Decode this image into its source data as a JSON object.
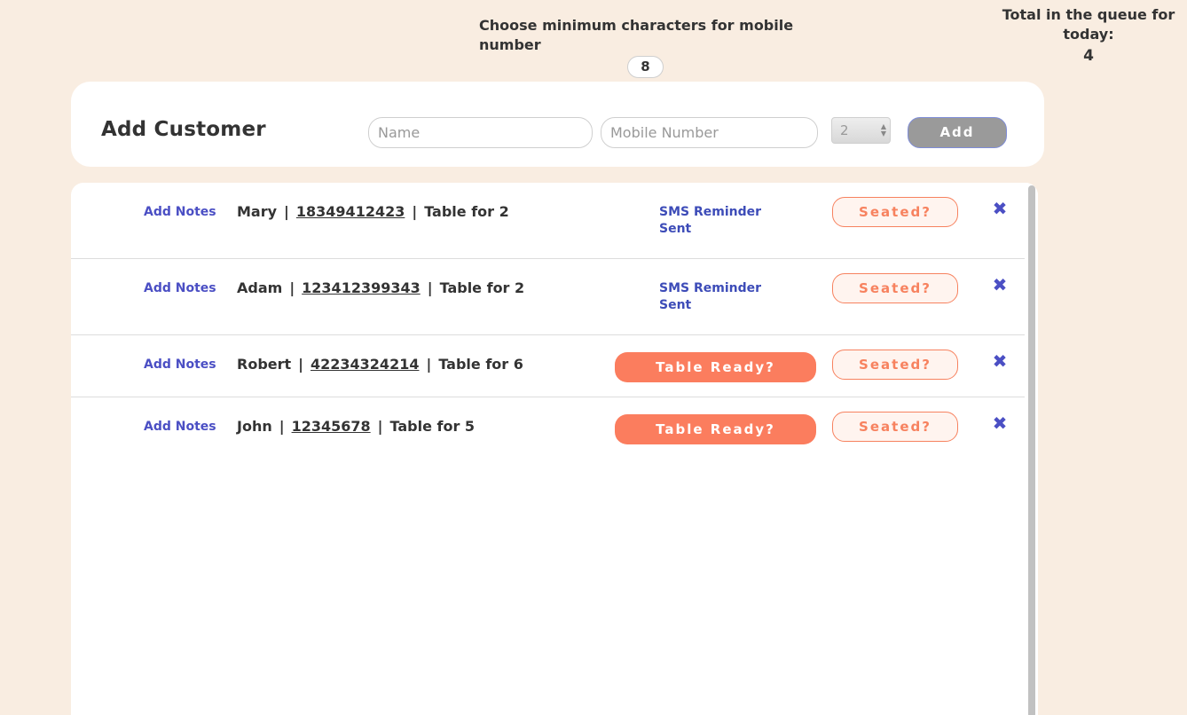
{
  "settings": {
    "min_chars_label": "Choose minimum characters for mobile number",
    "min_chars_value": "8"
  },
  "queue": {
    "total_label": "Total in the queue for today:",
    "total_count": "4"
  },
  "add_customer": {
    "title": "Add Customer",
    "name_placeholder": "Name",
    "mobile_placeholder": "Mobile Number",
    "party_size_value": "2",
    "add_label": "Add"
  },
  "colors": {
    "background": "#f9ede1",
    "accent_orange": "#fb7d5e",
    "link_blue": "#4b4fc4"
  },
  "customers": [
    {
      "notes_label": "Add Notes",
      "name": "Mary",
      "phone": "18349412423",
      "table": "Table for 2",
      "status": "SMS Reminder Sent",
      "seated_label": "Seated?",
      "remove_icon": "close-icon"
    },
    {
      "notes_label": "Add Notes",
      "name": "Adam",
      "phone": "123412399343",
      "table": "Table for 2",
      "status": "SMS Reminder Sent",
      "seated_label": "Seated?",
      "remove_icon": "close-icon"
    },
    {
      "notes_label": "Add Notes",
      "name": "Robert",
      "phone": "42234324214",
      "table": "Table for 6",
      "ready_label": "Table Ready?",
      "seated_label": "Seated?",
      "remove_icon": "close-icon"
    },
    {
      "notes_label": "Add Notes",
      "name": "John",
      "phone": "12345678",
      "table": "Table for 5",
      "ready_label": "Table Ready?",
      "seated_label": "Seated?",
      "remove_icon": "close-icon"
    }
  ]
}
